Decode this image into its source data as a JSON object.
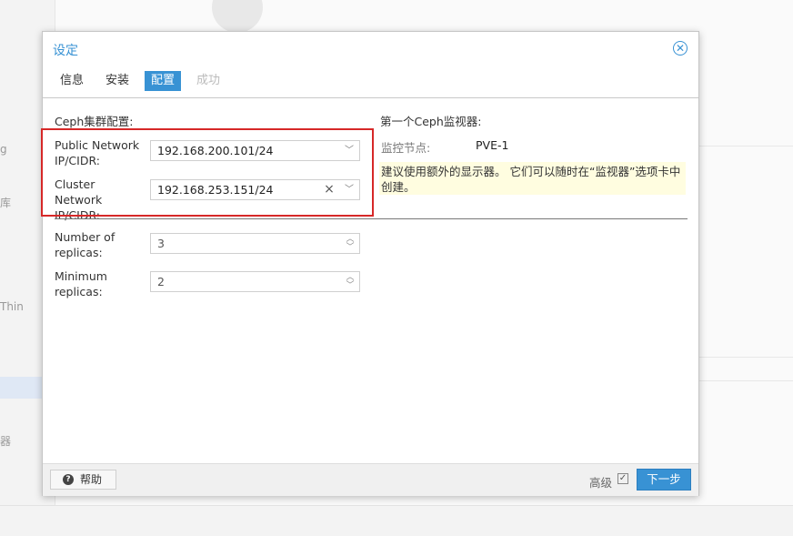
{
  "background": {
    "side_items": [
      "g",
      "库",
      "Thin",
      "器"
    ]
  },
  "dialog": {
    "title": "设定",
    "tabs": [
      {
        "label": "信息",
        "state": "normal"
      },
      {
        "label": "安装",
        "state": "normal"
      },
      {
        "label": "配置",
        "state": "active"
      },
      {
        "label": "成功",
        "state": "disabled"
      }
    ],
    "ceph_cluster": {
      "section_title": "Ceph集群配置:",
      "public_network": {
        "label": "Public Network IP/CIDR:",
        "value": "192.168.200.101/24"
      },
      "cluster_network": {
        "label": "Cluster Network IP/CIDR:",
        "value": "192.168.253.151/24"
      }
    },
    "replicas": {
      "number": {
        "label": "Number of replicas:",
        "value": "3"
      },
      "minimum": {
        "label": "Minimum replicas:",
        "value": "2"
      }
    },
    "monitor": {
      "section_title": "第一个Ceph监视器:",
      "node_label": "监控节点:",
      "node_value": "PVE-1",
      "hint": "建议使用额外的显示器。 它们可以随时在“监视器”选项卡中创建。"
    },
    "footer": {
      "help_label": "帮助",
      "advanced_label": "高级",
      "advanced_checked": true,
      "next_label": "下一步"
    }
  },
  "colors": {
    "accent": "#3892d4",
    "highlight_box": "#d62828",
    "hint_background": "#fffde0"
  }
}
